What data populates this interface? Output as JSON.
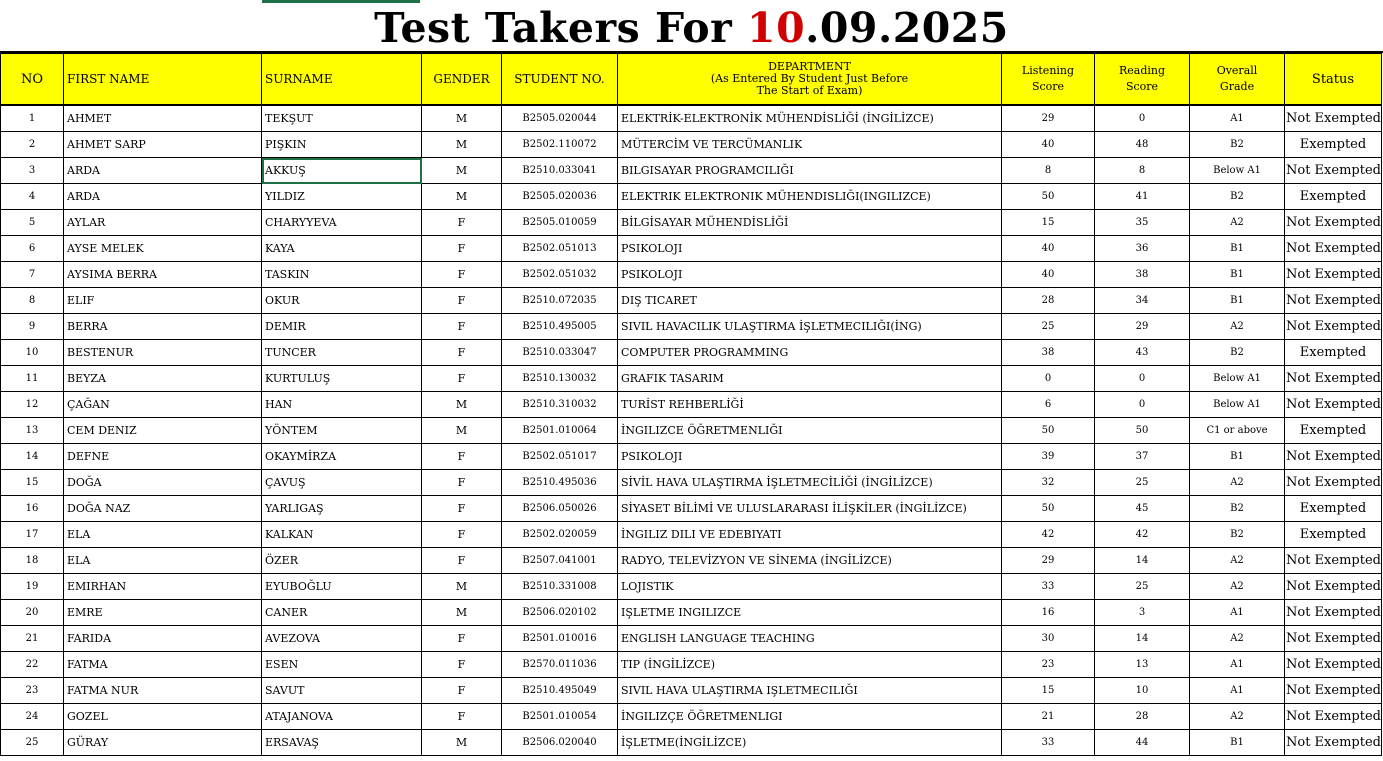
{
  "title": {
    "prefix": "Test Takers For ",
    "day": "10",
    "rest": ".09.2025"
  },
  "headers": {
    "no": "NO",
    "first_name": "FIRST NAME",
    "surname": "SURNAME",
    "gender": "GENDER",
    "student_no": "STUDENT NO.",
    "department_l1": "DEPARTMENT",
    "department_l2": "(As Entered By Student Just Before",
    "department_l3": "The Start of Exam)",
    "listening_l1": "Listening",
    "listening_l2": "Score",
    "reading_l1": "Reading",
    "reading_l2": "Score",
    "overall_l1": "Overall",
    "overall_l2": "Grade",
    "status": "Status"
  },
  "rows": [
    {
      "no": "1",
      "first": "AHMET",
      "surname": "TEKŞUT",
      "gender": "M",
      "student_no": "B2505.020044",
      "department": "ELEKTRİK-ELEKTRONİK MÜHENDİSLİĞİ (İNGİLİZCE)",
      "listening": "29",
      "reading": "0",
      "grade": "A1",
      "status": "Not Exempted"
    },
    {
      "no": "2",
      "first": "AHMET SARP",
      "surname": "PIŞKIN",
      "gender": "M",
      "student_no": "B2502.110072",
      "department": "MÜTERCİM VE TERCÜMANLIK",
      "listening": "40",
      "reading": "48",
      "grade": "B2",
      "status": "Exempted"
    },
    {
      "no": "3",
      "first": "ARDA",
      "surname": "AKKUŞ",
      "gender": "M",
      "student_no": "B2510.033041",
      "department": "BILGISAYAR PROGRAMCILIĞI",
      "listening": "8",
      "reading": "8",
      "grade": "Below A1",
      "status": "Not Exempted"
    },
    {
      "no": "4",
      "first": "ARDA",
      "surname": "YILDIZ",
      "gender": "M",
      "student_no": "B2505.020036",
      "department": "ELEKTRIK ELEKTRONIK MÜHENDISLIĞI(INGILIZCE)",
      "listening": "50",
      "reading": "41",
      "grade": "B2",
      "status": "Exempted"
    },
    {
      "no": "5",
      "first": "AYLAR",
      "surname": "CHARYYEVA",
      "gender": "F",
      "student_no": "B2505.010059",
      "department": "BİLGİSAYAR MÜHENDİSLİĞİ",
      "listening": "15",
      "reading": "35",
      "grade": "A2",
      "status": "Not Exempted"
    },
    {
      "no": "6",
      "first": "AYSE MELEK",
      "surname": "KAYA",
      "gender": "F",
      "student_no": "B2502.051013",
      "department": "PSIKOLOJI",
      "listening": "40",
      "reading": "36",
      "grade": "B1",
      "status": "Not Exempted"
    },
    {
      "no": "7",
      "first": "AYSIMA BERRA",
      "surname": "TASKIN",
      "gender": "F",
      "student_no": "B2502.051032",
      "department": "PSIKOLOJI",
      "listening": "40",
      "reading": "38",
      "grade": "B1",
      "status": "Not Exempted"
    },
    {
      "no": "8",
      "first": "ELIF",
      "surname": "OKUR",
      "gender": "F",
      "student_no": "B2510.072035",
      "department": "DIŞ TICARET",
      "listening": "28",
      "reading": "34",
      "grade": "B1",
      "status": "Not Exempted"
    },
    {
      "no": "9",
      "first": "BERRA",
      "surname": "DEMIR",
      "gender": "F",
      "student_no": "B2510.495005",
      "department": "SIVIL HAVACILIK ULAŞTIRMA İŞLETMECILIĞI(İNG)",
      "listening": "25",
      "reading": "29",
      "grade": "A2",
      "status": "Not Exempted"
    },
    {
      "no": "10",
      "first": "BESTENUR",
      "surname": "TUNCER",
      "gender": "F",
      "student_no": "B2510.033047",
      "department": "COMPUTER PROGRAMMING",
      "listening": "38",
      "reading": "43",
      "grade": "B2",
      "status": "Exempted"
    },
    {
      "no": "11",
      "first": "BEYZA",
      "surname": "KURTULUŞ",
      "gender": "F",
      "student_no": "B2510.130032",
      "department": "GRAFIK TASARIM",
      "listening": "0",
      "reading": "0",
      "grade": "Below A1",
      "status": "Not Exempted"
    },
    {
      "no": "12",
      "first": "ÇAĞAN",
      "surname": "HAN",
      "gender": "M",
      "student_no": "B2510.310032",
      "department": "TURİST REHBERLİĞİ",
      "listening": "6",
      "reading": "0",
      "grade": "Below A1",
      "status": "Not Exempted"
    },
    {
      "no": "13",
      "first": "CEM DENIZ",
      "surname": "YÖNTEM",
      "gender": "M",
      "student_no": "B2501.010064",
      "department": "İNGILIZCE ÖĞRETMENLIĞI",
      "listening": "50",
      "reading": "50",
      "grade": "C1 or above",
      "status": "Exempted"
    },
    {
      "no": "14",
      "first": "DEFNE",
      "surname": "OKAYMİRZA",
      "gender": "F",
      "student_no": "B2502.051017",
      "department": "PSIKOLOJI",
      "listening": "39",
      "reading": "37",
      "grade": "B1",
      "status": "Not Exempted"
    },
    {
      "no": "15",
      "first": "DOĞA",
      "surname": "ÇAVUŞ",
      "gender": "F",
      "student_no": "B2510.495036",
      "department": "SİVİL HAVA ULAŞTIRMA İŞLETMECİLİĞİ (İNGİLİZCE)",
      "listening": "32",
      "reading": "25",
      "grade": "A2",
      "status": "Not Exempted"
    },
    {
      "no": "16",
      "first": "DOĞA NAZ",
      "surname": "YARLIGAŞ",
      "gender": "F",
      "student_no": "B2506.050026",
      "department": "SİYASET BİLİMİ VE ULUSLARARASI İLİŞKİLER (İNGİLİZCE)",
      "listening": "50",
      "reading": "45",
      "grade": "B2",
      "status": "Exempted"
    },
    {
      "no": "17",
      "first": "ELA",
      "surname": "KALKAN",
      "gender": "F",
      "student_no": "B2502.020059",
      "department": "İNGILIZ DILI VE EDEBIYATI",
      "listening": "42",
      "reading": "42",
      "grade": "B2",
      "status": "Exempted"
    },
    {
      "no": "18",
      "first": "ELA",
      "surname": "ÖZER",
      "gender": "F",
      "student_no": "B2507.041001",
      "department": "RADYO, TELEVİZYON VE SİNEMA (İNGİLİZCE)",
      "listening": "29",
      "reading": "14",
      "grade": "A2",
      "status": "Not Exempted"
    },
    {
      "no": "19",
      "first": "EMIRHAN",
      "surname": "EYUBOĞLU",
      "gender": "M",
      "student_no": "B2510.331008",
      "department": "LOJISTIK",
      "listening": "33",
      "reading": "25",
      "grade": "A2",
      "status": "Not Exempted"
    },
    {
      "no": "20",
      "first": "EMRE",
      "surname": "CANER",
      "gender": "M",
      "student_no": "B2506.020102",
      "department": "IŞLETME INGILIZCE",
      "listening": "16",
      "reading": "3",
      "grade": "A1",
      "status": "Not Exempted"
    },
    {
      "no": "21",
      "first": "FARIDA",
      "surname": "AVEZOVA",
      "gender": "F",
      "student_no": "B2501.010016",
      "department": "ENGLISH LANGUAGE TEACHING",
      "listening": "30",
      "reading": "14",
      "grade": "A2",
      "status": "Not Exempted"
    },
    {
      "no": "22",
      "first": "FATMA",
      "surname": "ESEN",
      "gender": "F",
      "student_no": "B2570.011036",
      "department": "TIP (İNGİLİZCE)",
      "listening": "23",
      "reading": "13",
      "grade": "A1",
      "status": "Not Exempted"
    },
    {
      "no": "23",
      "first": "FATMA NUR",
      "surname": "SAVUT",
      "gender": "F",
      "student_no": "B2510.495049",
      "department": "SIVIL HAVA ULAŞTIRMA IŞLETMECILIĞI",
      "listening": "15",
      "reading": "10",
      "grade": "A1",
      "status": "Not Exempted"
    },
    {
      "no": "24",
      "first": "GOZEL",
      "surname": "ATAJANOVA",
      "gender": "F",
      "student_no": "B2501.010054",
      "department": "İNGILIZÇE ÖĞRETMENLIGI",
      "listening": "21",
      "reading": "28",
      "grade": "A2",
      "status": "Not Exempted"
    },
    {
      "no": "25",
      "first": "GÜRAY",
      "surname": "ERSAVAŞ",
      "gender": "M",
      "student_no": "B2506.020040",
      "department": "İŞLETME(İNGİLİZCE)",
      "listening": "33",
      "reading": "44",
      "grade": "B1",
      "status": "Not Exempted"
    }
  ],
  "colors": {
    "header_bg": "#ffff00",
    "title_red": "#d00000",
    "selection": "#1e7145"
  }
}
